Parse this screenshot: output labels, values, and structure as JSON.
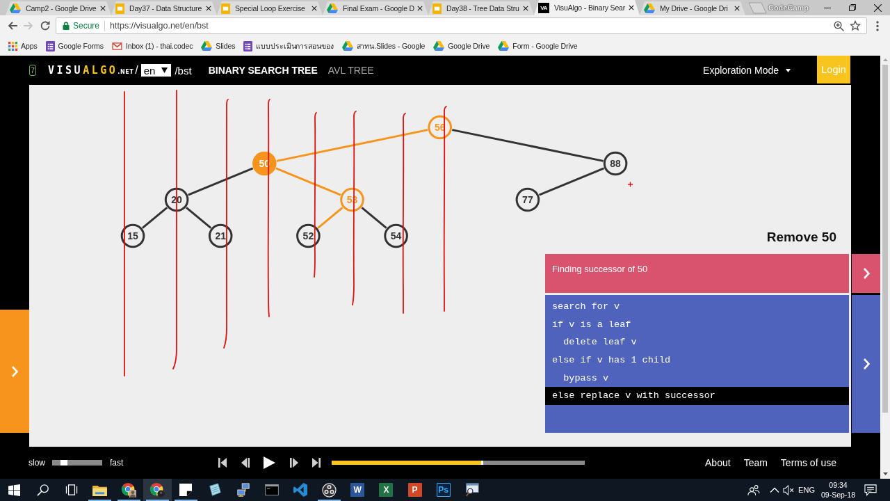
{
  "browser": {
    "tabs": [
      {
        "title": "Camp2 - Google Drive",
        "kind": "drive",
        "selected": false
      },
      {
        "title": "Day37 - Data Structure",
        "kind": "slides",
        "selected": false
      },
      {
        "title": "Special Loop Exercise",
        "kind": "slides",
        "selected": false
      },
      {
        "title": "Final Exam - Google D",
        "kind": "drive",
        "selected": false
      },
      {
        "title": "Day38 - Tree Data Stru",
        "kind": "slides",
        "selected": false
      },
      {
        "title": "VisuAlgo - Binary Sear",
        "kind": "site",
        "icon_text": "VA",
        "selected": true
      },
      {
        "title": "My Drive - Google Dri",
        "kind": "drive",
        "selected": false
      }
    ],
    "profile": "CodeCamp",
    "nav": [
      {
        "kind": "back",
        "disabled": false
      },
      {
        "kind": "forward",
        "disabled": true
      },
      {
        "kind": "reload",
        "disabled": false
      }
    ],
    "security": "Secure",
    "url": "https://visualgo.net/en/bst",
    "bookmarks": [
      {
        "label": "Apps",
        "kind": "apps"
      },
      {
        "label": "Google Forms",
        "kind": "forms"
      },
      {
        "label": "Inbox (1) - thai.codec",
        "kind": "mail"
      },
      {
        "label": "Slides",
        "kind": "drive"
      },
      {
        "label": "แบบประเมินการสอนของ",
        "kind": "forms"
      },
      {
        "label": "สาทน.Slides - Google",
        "kind": "drive"
      },
      {
        "label": "Google Drive",
        "kind": "drive"
      },
      {
        "label": "Form - Google Drive",
        "kind": "drive"
      }
    ]
  },
  "header": {
    "badge": "7",
    "logo": {
      "first": "VISU",
      "second": "ALGO",
      "domain": ".NET"
    },
    "separator": "/",
    "language": "en",
    "path": "/bst",
    "modes": [
      {
        "label": "BINARY SEARCH TREE",
        "selected": true
      },
      {
        "label": "AVL TREE",
        "selected": false
      }
    ],
    "mode_menu": "Exploration Mode",
    "login": "Login"
  },
  "stage": {
    "tree": {
      "value": "56",
      "current": false,
      "highlighted": true,
      "children": [
        {
          "value": "50",
          "is_left": true,
          "current": true,
          "highlighted": true,
          "edge_highlighted": true,
          "children": [
            {
              "value": "20",
              "is_left": true,
              "current": false,
              "highlighted": false,
              "edge_highlighted": false,
              "children": [
                {
                  "value": "15",
                  "is_left": true,
                  "current": false,
                  "highlighted": false,
                  "edge_highlighted": false
                },
                {
                  "value": "21",
                  "is_left": false,
                  "current": false,
                  "highlighted": false,
                  "edge_highlighted": false
                }
              ]
            },
            {
              "value": "53",
              "is_left": false,
              "current": false,
              "highlighted": true,
              "edge_highlighted": true,
              "children": [
                {
                  "value": "52",
                  "is_left": true,
                  "current": false,
                  "highlighted": false,
                  "edge_highlighted": true
                },
                {
                  "value": "54",
                  "is_left": false,
                  "current": false,
                  "highlighted": false,
                  "edge_highlighted": false
                }
              ]
            }
          ]
        },
        {
          "value": "88",
          "is_left": false,
          "current": false,
          "highlighted": false,
          "edge_highlighted": false,
          "children": [
            {
              "value": "77",
              "is_left": true,
              "current": false,
              "highlighted": false,
              "edge_highlighted": false
            }
          ]
        }
      ]
    },
    "hand_drawn_marks": true,
    "title": "Remove 50",
    "status": "Finding successor of 50",
    "code": [
      {
        "text": "search for v",
        "selected": false
      },
      {
        "text": "if v is a leaf",
        "selected": false
      },
      {
        "text": "  delete leaf v",
        "selected": false
      },
      {
        "text": "else if v has 1 child",
        "selected": false
      },
      {
        "text": "  bypass v",
        "selected": false
      },
      {
        "text": "else replace v with successor",
        "selected": true
      }
    ]
  },
  "playback": {
    "slow": "slow",
    "fast": "fast",
    "speed": {
      "level": 0.2
    },
    "controls": [
      {
        "kind": "first"
      },
      {
        "kind": "previous"
      },
      {
        "kind": "play"
      },
      {
        "kind": "next"
      },
      {
        "kind": "last"
      }
    ],
    "progress": {
      "level": 0.6
    }
  },
  "footer_links": [
    "About",
    "Team",
    "Terms of use"
  ],
  "taskbar": {
    "items": [
      {
        "kind": "start",
        "running": false,
        "selected": false
      },
      {
        "kind": "search",
        "running": false,
        "selected": false
      },
      {
        "kind": "task_view",
        "running": false,
        "selected": false
      },
      {
        "kind": "folder",
        "running": true,
        "selected": false
      },
      {
        "kind": "browser_profile",
        "running": true,
        "selected": false
      },
      {
        "kind": "browser",
        "running": true,
        "selected": true
      },
      {
        "kind": "note",
        "running": true,
        "selected": false
      },
      {
        "kind": "notepad",
        "running": false,
        "selected": false
      },
      {
        "kind": "network",
        "running": false,
        "selected": false
      },
      {
        "kind": "terminal",
        "running": false,
        "selected": false
      },
      {
        "kind": "code_editor",
        "running": false,
        "selected": false
      },
      {
        "kind": "recorder",
        "running": true,
        "selected": false
      },
      {
        "kind": "document",
        "label": "W",
        "running": false,
        "selected": false
      },
      {
        "kind": "spreadsheet",
        "label": "X",
        "running": false,
        "selected": false
      },
      {
        "kind": "presentation",
        "label": "P",
        "running": false,
        "selected": false
      },
      {
        "kind": "letter_tile",
        "label": "Ps",
        "running": false,
        "selected": false
      },
      {
        "kind": "magnifier",
        "running": false,
        "selected": false
      }
    ],
    "tray": {
      "language": "ENG",
      "time": "09:34",
      "date": "09-Sep-18"
    }
  }
}
